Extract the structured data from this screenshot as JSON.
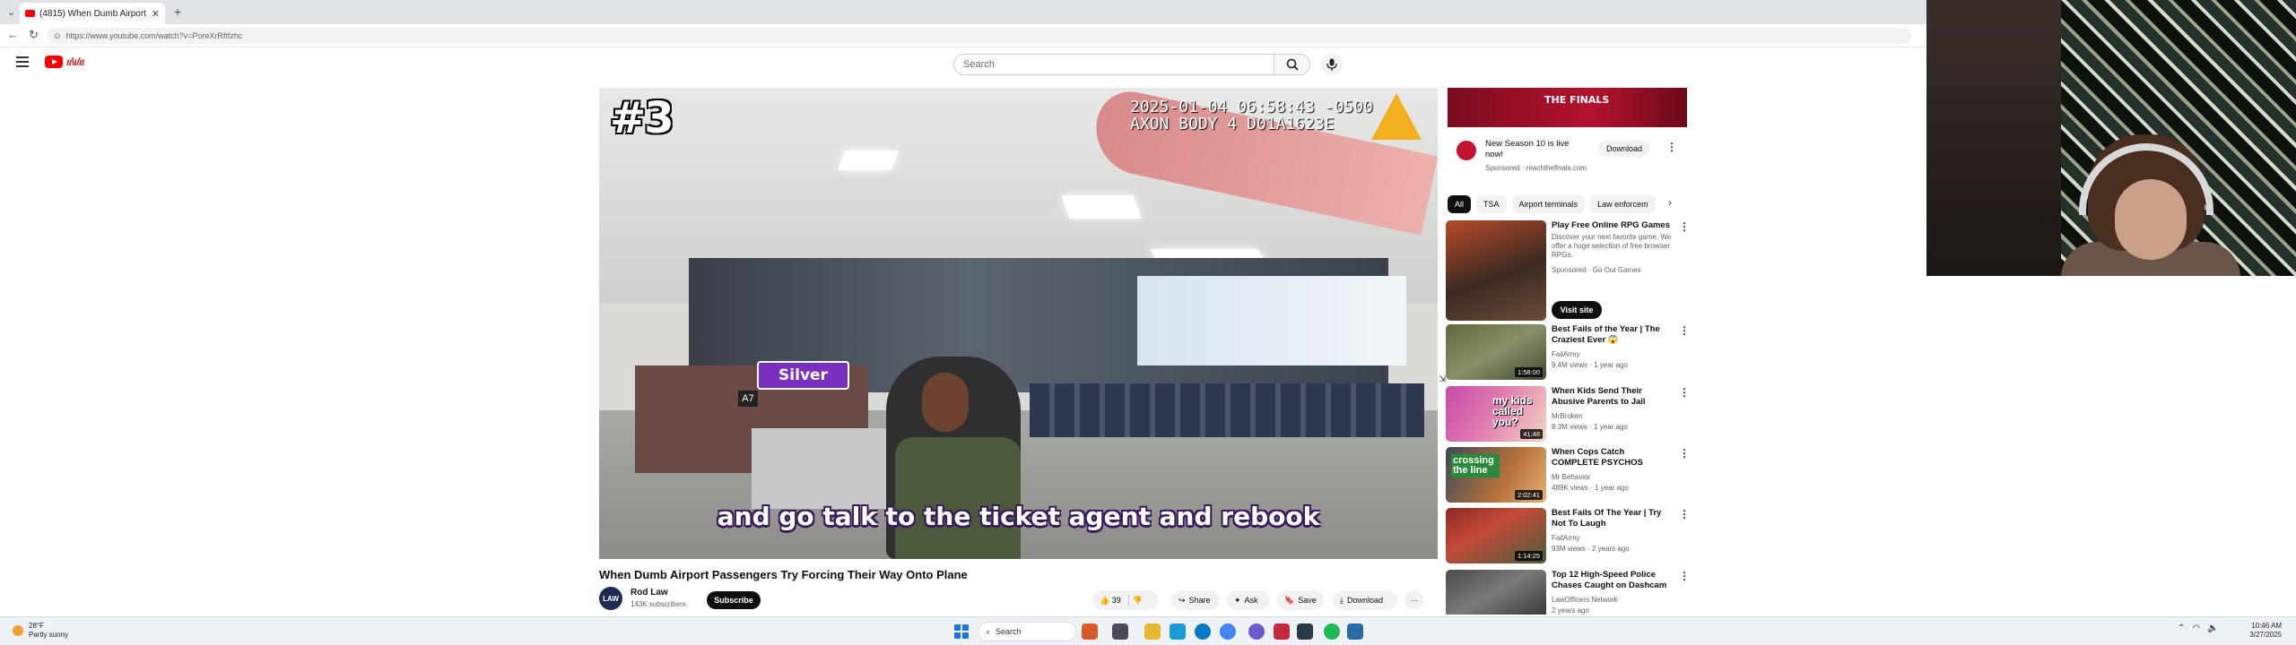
{
  "browser": {
    "tab_title": "(4815) When Dumb Airport P",
    "url": "https://www.youtube.com/watch?v=PoreXrRftfzhc"
  },
  "header": {
    "search_placeholder": "Search"
  },
  "video": {
    "episode_badge": "#3",
    "timestamp_line1": "2025-01-04 06:58:43 -0500",
    "timestamp_line2": "AXON BODY 4 D01A1623E",
    "sign_text": "Silver",
    "gate_text": "A7",
    "caption": "and go talk to the ticket agent and rebook",
    "title": "When Dumb Airport Passengers Try Forcing Their Way Onto Plane"
  },
  "channel": {
    "avatar_text": "LAW",
    "name": "Rod Law",
    "subscribers": "143K subscribers",
    "subscribe_label": "Subscribe"
  },
  "actions": {
    "likes": "39",
    "share": "Share",
    "ask": "Ask",
    "save": "Save",
    "download": "Download"
  },
  "sidebar": {
    "ad": {
      "banner_text": "THE FINALS",
      "title": "New Season 10 is live now!",
      "sponsored": "Sponsored · reachthefinals.com",
      "button": "Download"
    },
    "chips": [
      "All",
      "TSA",
      "Airport terminals",
      "Law enforcem"
    ],
    "promo": {
      "title": "Play Free Online RPG Games",
      "desc": "Discover your next favorite game. We offer a huge selection of free browser RPGs.",
      "sponsored": "Sponsored · Go Out Games",
      "button": "Visit site"
    },
    "videos": [
      {
        "title": "Best Fails of the Year | The Craziest Ever 😱",
        "channel": "FailArmy",
        "stats": "9.4M views · 1 year ago",
        "duration": "1:58:00"
      },
      {
        "title": "When Kids Send Their Abusive Parents to Jail",
        "channel": "MrBroken",
        "stats": "8.3M views · 1 year ago",
        "duration": "41:48",
        "thumb_text": "my kids called you?"
      },
      {
        "title": "When Cops Catch COMPLETE PSYCHOS",
        "channel": "Mr Behavior",
        "stats": "489K views · 1 year ago",
        "duration": "2:02:41",
        "thumb_text": "crossing the line"
      },
      {
        "title": "Best Fails Of The Year | Try Not To Laugh",
        "channel": "FailArmy",
        "stats": "93M views · 2 years ago",
        "duration": "1:14:25"
      },
      {
        "title": "Top 12 High-Speed Police Chases Caught on Dashcam",
        "channel": "LawOfficers Network",
        "stats": "2 years ago",
        "duration": ""
      }
    ]
  },
  "taskbar": {
    "weather_temp": "28°F",
    "weather_desc": "Partly sunny",
    "search": "Search",
    "time": "10:46 AM",
    "date": "3/27/2025"
  },
  "colors": {
    "youtube_red": "#ff0000",
    "caption_outline": "#3a1b5e",
    "sign_purple": "#7b2fbe",
    "axon_yellow": "#f2b01e"
  }
}
